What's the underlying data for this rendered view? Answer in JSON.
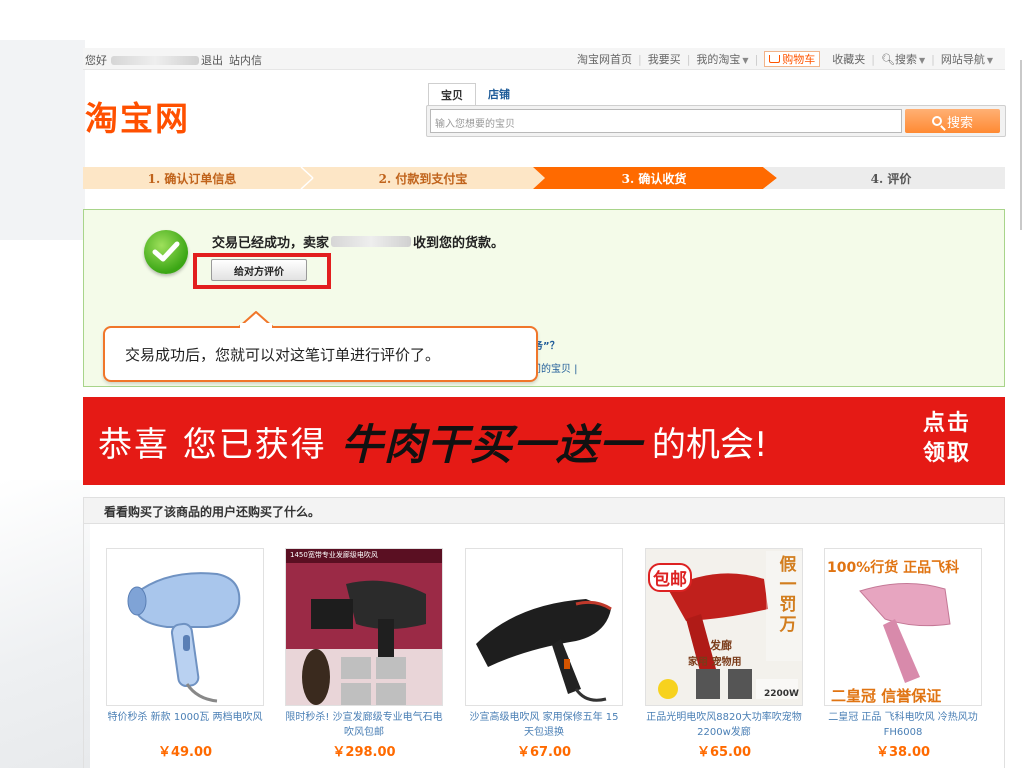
{
  "topbar": {
    "greeting": "您好",
    "logout": "退出",
    "inbox": "站内信",
    "links": [
      "淘宝网首页",
      "我要买",
      "我的淘宝",
      "购物车",
      "收藏夹",
      "搜索",
      "网站导航"
    ]
  },
  "logo": "淘宝网",
  "search": {
    "tabs": [
      "宝贝",
      "店铺"
    ],
    "placeholder": "输入您想要的宝贝",
    "button": "搜索"
  },
  "steps": [
    "1. 确认订单信息",
    "2. 付款到支付宝",
    "3. 确认收货",
    "4. 评价"
  ],
  "success": {
    "message_pre": "交易已经成功，卖家",
    "message_post": "收到您的货款。",
    "rate_button": "给对方评价",
    "partial_link_1": "务”？",
    "partial_link_2": "间的宝贝 |"
  },
  "tooltip": "交易成功后，您就可以对这笔订单进行评价了。",
  "banner": {
    "part1": "恭喜 您已获得",
    "part2": "牛肉干买一送一",
    "part3": "的机会!",
    "cta": "点击领取"
  },
  "recommend": {
    "header": "看看购买了该商品的用户还购买了什么。",
    "products": [
      {
        "title": "特价秒杀 新款 1000瓦 两档电吹风",
        "price": "￥49.00"
      },
      {
        "title": "限时秒杀! 沙宣发廊级专业电气石电吹风包邮",
        "price": "￥298.00",
        "overlay": "1450宽带专业发廊级电吹风"
      },
      {
        "title": "沙宣高级电吹风 家用保修五年 15天包退换",
        "price": "￥67.00"
      },
      {
        "title": "正品光明电吹风8820大功率吹宠物2200w发廊",
        "price": "￥65.00",
        "overlay": [
          "包邮",
          "假一罚万",
          "发廊",
          "家用 宠物用",
          "2200W"
        ]
      },
      {
        "title": "二皇冠 正品 飞科电吹风 冷热风功 FH6008",
        "price": "￥38.00",
        "overlay": [
          "100%行货 正品飞科",
          "二皇冠 信誉保证"
        ]
      }
    ]
  }
}
